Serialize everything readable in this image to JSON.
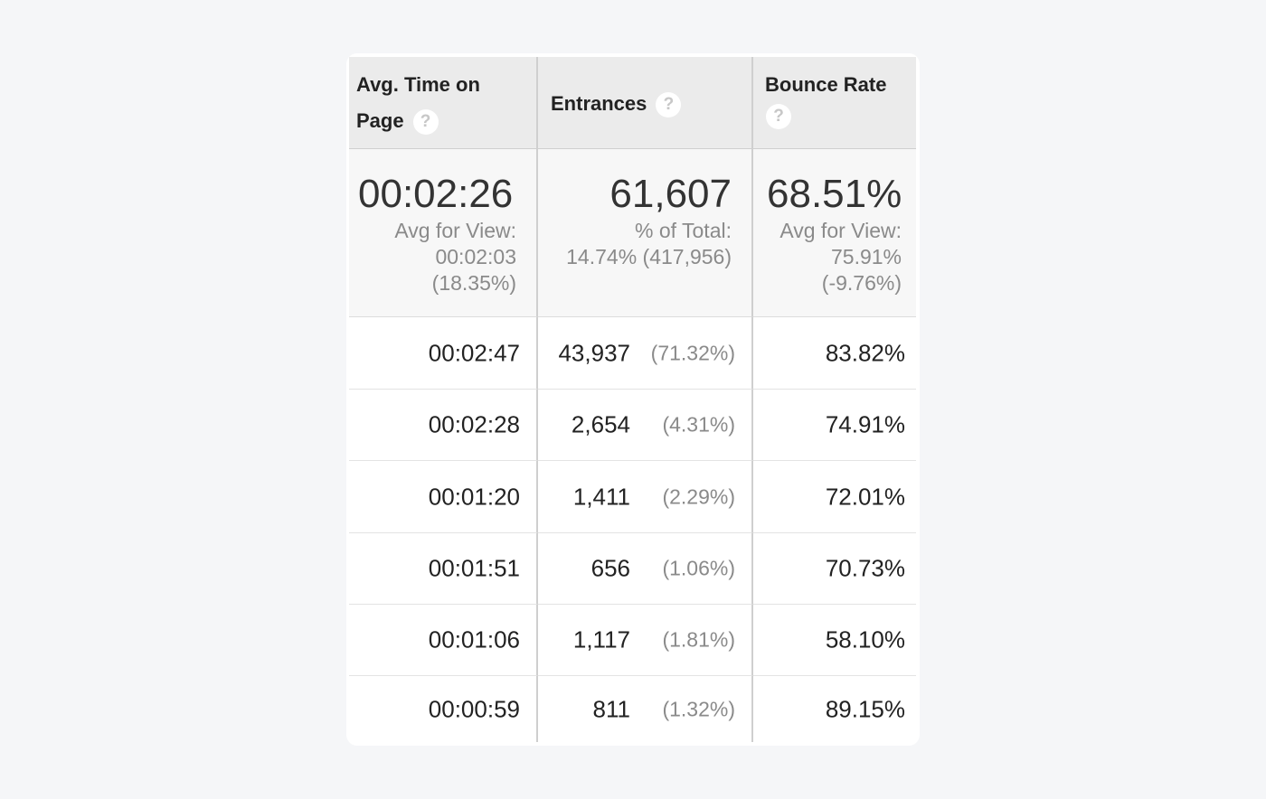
{
  "headers": {
    "avg_time_line1": "Avg. Time on",
    "avg_time_line2": "Page",
    "entrances": "Entrances",
    "bounce_rate": "Bounce Rate",
    "help_glyph": "?"
  },
  "summary": {
    "avg_time": {
      "value": "00:02:26",
      "line1": "Avg for View:",
      "line2": "00:02:03",
      "line3": "(18.35%)"
    },
    "entrances": {
      "value": "61,607",
      "line1": "% of Total:",
      "line2": "14.74% (417,956)"
    },
    "bounce_rate": {
      "value": "68.51%",
      "line1": "Avg for View:",
      "line2": "75.91%",
      "line3": "(-9.76%)"
    }
  },
  "rows": [
    {
      "avg_time": "00:02:47",
      "entrances": "43,937",
      "entrances_pct": "(71.32%)",
      "bounce_rate": "83.82%"
    },
    {
      "avg_time": "00:02:28",
      "entrances": "2,654",
      "entrances_pct": "(4.31%)",
      "bounce_rate": "74.91%"
    },
    {
      "avg_time": "00:01:20",
      "entrances": "1,411",
      "entrances_pct": "(2.29%)",
      "bounce_rate": "72.01%"
    },
    {
      "avg_time": "00:01:51",
      "entrances": "656",
      "entrances_pct": "(1.06%)",
      "bounce_rate": "70.73%"
    },
    {
      "avg_time": "00:01:06",
      "entrances": "1,117",
      "entrances_pct": "(1.81%)",
      "bounce_rate": "58.10%"
    },
    {
      "avg_time": "00:00:59",
      "entrances": "811",
      "entrances_pct": "(1.32%)",
      "bounce_rate": "89.15%"
    }
  ]
}
